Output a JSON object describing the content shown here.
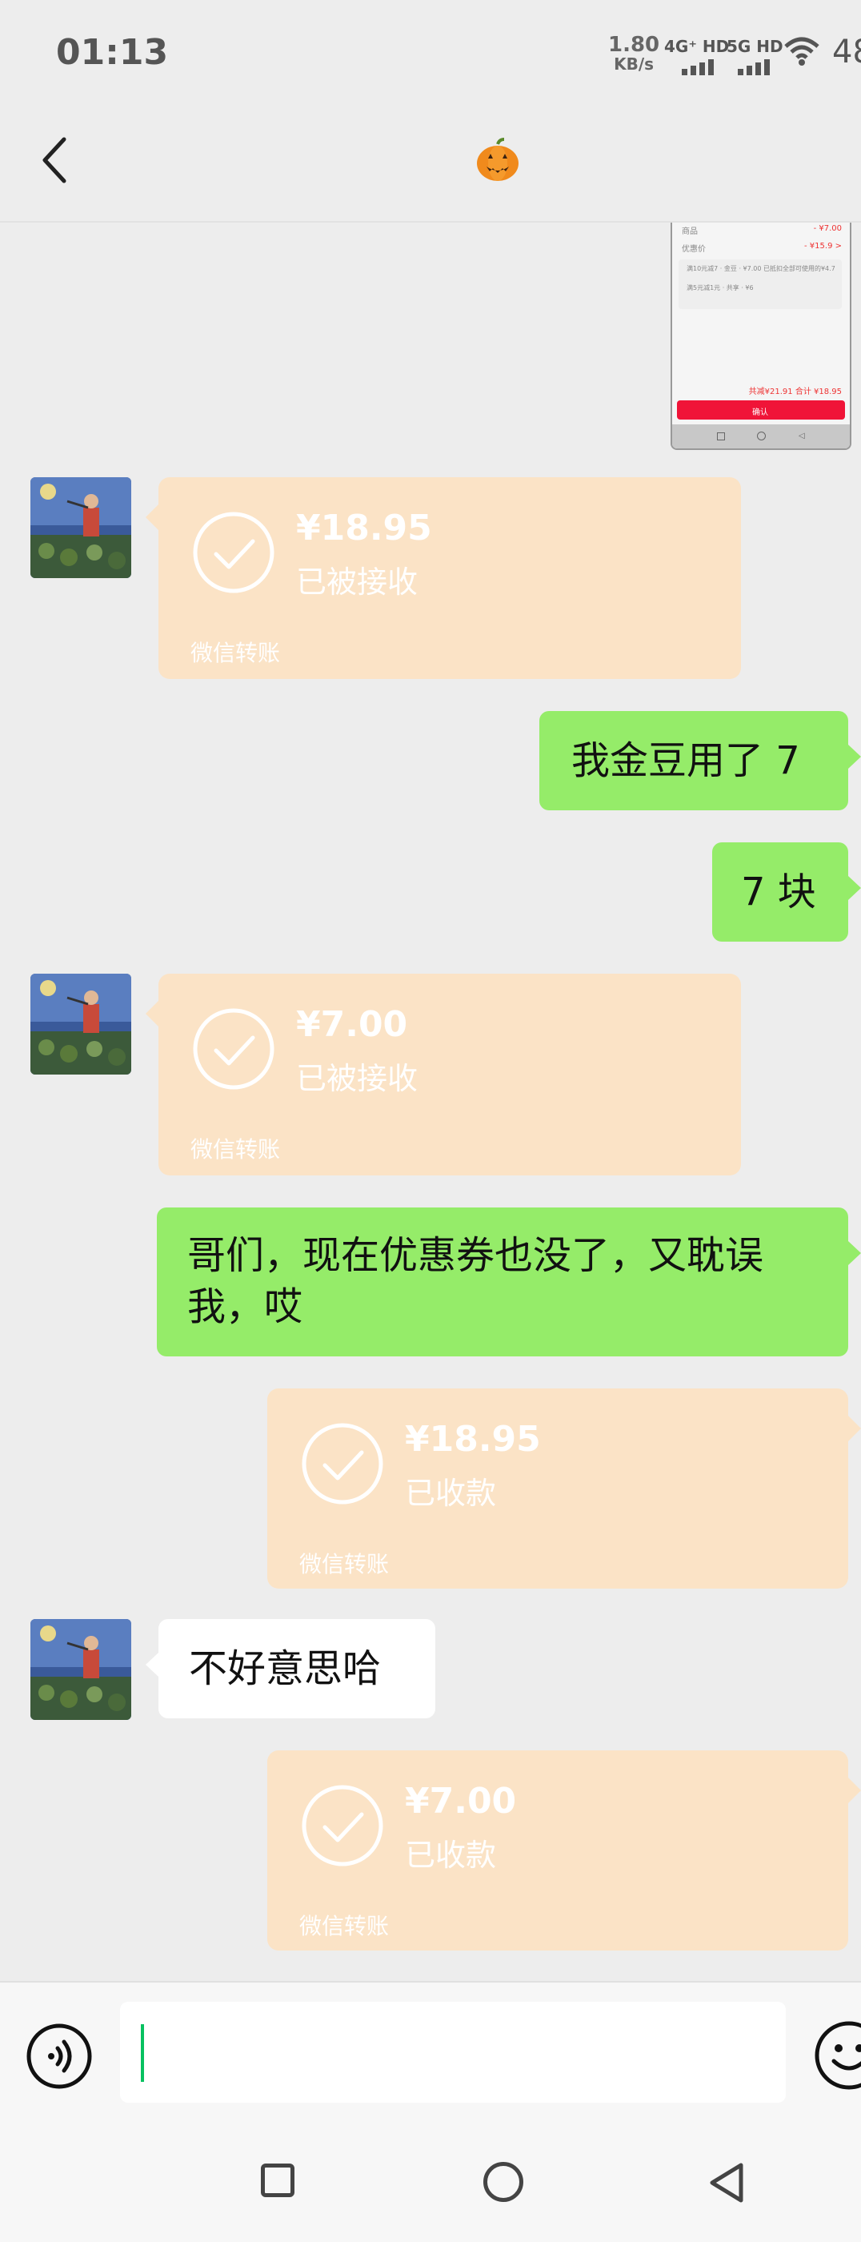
{
  "status_bar": {
    "time": "01:13",
    "net_speed_value": "1.80",
    "net_speed_unit": "KB/s",
    "signal1": "4G⁺ HD",
    "signal2": "5G HD",
    "battery": "48"
  },
  "header": {
    "back_icon": "chevron-left-icon",
    "title_emoji": "🎃"
  },
  "thumbnail": {
    "row1_left": "商品",
    "row1_right": "- ¥7.00",
    "row2_left": "优惠价",
    "row2_right": "- ¥15.9 >",
    "row3": "满10元减7 · 金豆 · ¥7.00 已抵扣全部可使用的¥4.7",
    "row4": "满5元减1元 · 共享 · ¥6",
    "total_line": "共减¥21.91 合计 ¥18.95",
    "confirm": "确认"
  },
  "messages": [
    {
      "type": "transfer",
      "side": "left",
      "amount": "¥18.95",
      "status": "已被接收",
      "footer": "微信转账"
    },
    {
      "type": "text",
      "side": "right",
      "text": "我金豆用了 7"
    },
    {
      "type": "text",
      "side": "right",
      "text": "7 块"
    },
    {
      "type": "transfer",
      "side": "left",
      "amount": "¥7.00",
      "status": "已被接收",
      "footer": "微信转账"
    },
    {
      "type": "text",
      "side": "right",
      "line1": "哥们，现在优惠券也没了，又耽误",
      "line2": "我，哎"
    },
    {
      "type": "transfer",
      "side": "right",
      "amount": "¥18.95",
      "status": "已收款",
      "footer": "微信转账"
    },
    {
      "type": "text",
      "side": "left",
      "text": "不好意思哈"
    },
    {
      "type": "transfer",
      "side": "right",
      "amount": "¥7.00",
      "status": "已收款",
      "footer": "微信转账"
    }
  ],
  "input": {
    "voice_icon": "voice-icon",
    "emoji_icon": "emoji-icon",
    "value": ""
  },
  "colors": {
    "bubble_green": "#95ec69",
    "transfer_bg": "#fbe3c6",
    "cursor": "#07c160",
    "background": "#ededed"
  }
}
